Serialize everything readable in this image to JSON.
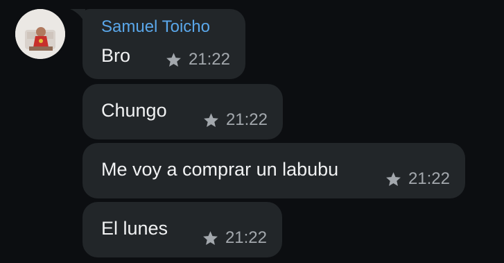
{
  "sender": {
    "name": "Samuel Toicho",
    "name_color": "#5aa7ea"
  },
  "messages": [
    {
      "text": "Bro",
      "time": "21:22",
      "icon": "star-icon"
    },
    {
      "text": "Chungo",
      "time": "21:22",
      "icon": "star-icon"
    },
    {
      "text": "Me voy a comprar un labubu",
      "time": "21:22",
      "icon": "star-icon"
    },
    {
      "text": "El lunes",
      "time": "21:22",
      "icon": "star-icon"
    }
  ],
  "colors": {
    "background": "#0c0e11",
    "bubble": "#222629",
    "message_text": "#f1f2f3",
    "timestamp": "#a3a8ad"
  }
}
